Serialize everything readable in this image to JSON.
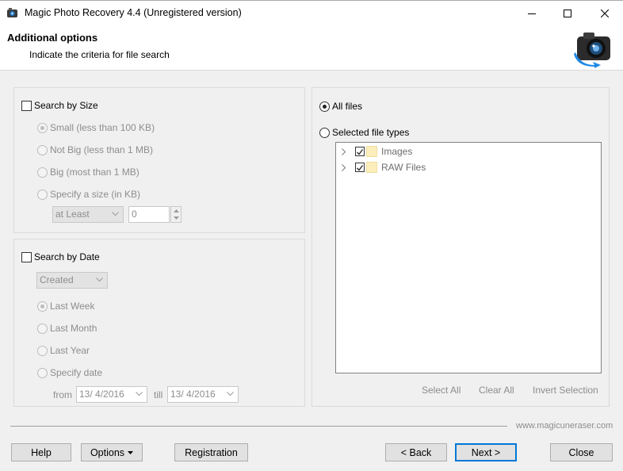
{
  "window": {
    "title": "Magic Photo Recovery 4.4 (Unregistered version)"
  },
  "header": {
    "title": "Additional options",
    "subtitle": "Indicate the criteria for file search"
  },
  "size": {
    "checkbox_label": "Search by Size",
    "options": [
      "Small (less than 100 KB)",
      "Not Big (less than 1 MB)",
      "Big (most than 1 MB)",
      "Specify a size (in KB)"
    ],
    "comparator": "at Least",
    "value": "0"
  },
  "date": {
    "checkbox_label": "Search by Date",
    "field": "Created",
    "options": [
      "Last Week",
      "Last Month",
      "Last Year",
      "Specify date"
    ],
    "from_label": "from",
    "from_value": "13/  4/2016",
    "till_label": "till",
    "till_value": "13/  4/2016"
  },
  "filetypes": {
    "all_files": "All files",
    "selected_types": "Selected file types",
    "tree": [
      "Images",
      "RAW Files"
    ],
    "select_all": "Select All",
    "clear_all": "Clear All",
    "invert_selection": "Invert Selection"
  },
  "footer": {
    "site": "www.magicuneraser.com",
    "help": "Help",
    "options": "Options",
    "registration": "Registration",
    "back": "< Back",
    "next": "Next >",
    "close": "Close"
  }
}
